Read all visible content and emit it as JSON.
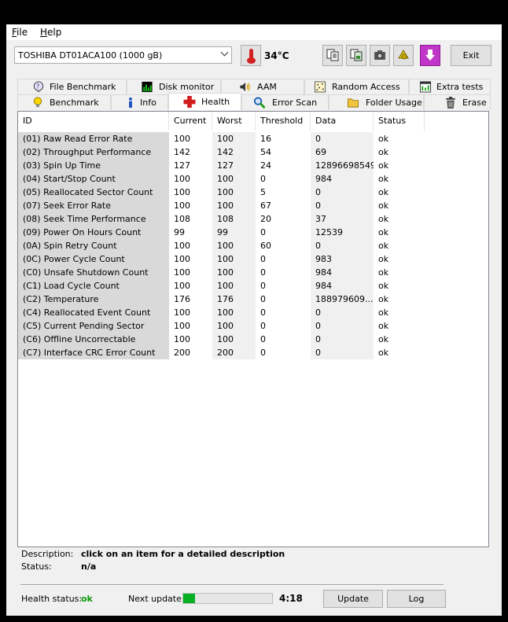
{
  "menu": {
    "file": "File",
    "help": "Help"
  },
  "toolbar": {
    "drive": "TOSHIBA DT01ACA100 (1000 gB)",
    "temperature": "34°C",
    "exit_label": "Exit"
  },
  "tabs_top": [
    {
      "label": "File Benchmark",
      "icon": "file-benchmark-icon"
    },
    {
      "label": "Disk monitor",
      "icon": "disk-monitor-icon"
    },
    {
      "label": "AAM",
      "icon": "speaker-icon"
    },
    {
      "label": "Random Access",
      "icon": "random-access-icon"
    },
    {
      "label": "Extra tests",
      "icon": "extra-tests-icon"
    }
  ],
  "tabs_bottom": [
    {
      "label": "Benchmark",
      "icon": "lightbulb-icon"
    },
    {
      "label": "Info",
      "icon": "info-icon"
    },
    {
      "label": "Health",
      "icon": "health-cross-icon",
      "active": true
    },
    {
      "label": "Error Scan",
      "icon": "magnifier-icon"
    },
    {
      "label": "Folder Usage",
      "icon": "folder-icon"
    },
    {
      "label": "Erase",
      "icon": "trash-icon"
    }
  ],
  "table": {
    "columns": [
      "ID",
      "Current",
      "Worst",
      "Threshold",
      "Data",
      "Status"
    ],
    "rows": [
      [
        "(01) Raw Read Error Rate",
        "100",
        "100",
        "16",
        "0",
        "ok"
      ],
      [
        "(02) Throughput Performance",
        "142",
        "142",
        "54",
        "69",
        "ok"
      ],
      [
        "(03) Spin Up Time",
        "127",
        "127",
        "24",
        "12896698549",
        "ok"
      ],
      [
        "(04) Start/Stop Count",
        "100",
        "100",
        "0",
        "984",
        "ok"
      ],
      [
        "(05) Reallocated Sector Count",
        "100",
        "100",
        "5",
        "0",
        "ok"
      ],
      [
        "(07) Seek Error Rate",
        "100",
        "100",
        "67",
        "0",
        "ok"
      ],
      [
        "(08) Seek Time Performance",
        "108",
        "108",
        "20",
        "37",
        "ok"
      ],
      [
        "(09) Power On Hours Count",
        "99",
        "99",
        "0",
        "12539",
        "ok"
      ],
      [
        "(0A) Spin Retry Count",
        "100",
        "100",
        "60",
        "0",
        "ok"
      ],
      [
        "(0C) Power Cycle Count",
        "100",
        "100",
        "0",
        "983",
        "ok"
      ],
      [
        "(C0) Unsafe Shutdown Count",
        "100",
        "100",
        "0",
        "984",
        "ok"
      ],
      [
        "(C1) Load Cycle Count",
        "100",
        "100",
        "0",
        "984",
        "ok"
      ],
      [
        "(C2) Temperature",
        "176",
        "176",
        "0",
        "188979609...",
        "ok"
      ],
      [
        "(C4) Reallocated Event Count",
        "100",
        "100",
        "0",
        "0",
        "ok"
      ],
      [
        "(C5) Current Pending Sector",
        "100",
        "100",
        "0",
        "0",
        "ok"
      ],
      [
        "(C6) Offline Uncorrectable",
        "100",
        "100",
        "0",
        "0",
        "ok"
      ],
      [
        "(C7) Interface CRC Error Count",
        "200",
        "200",
        "0",
        "0",
        "ok"
      ]
    ]
  },
  "description": {
    "desc_label": "Description:",
    "desc_value": "click on an item for a detailed description",
    "status_label": "Status:",
    "status_value": "n/a"
  },
  "statusbar": {
    "health_label": "Health status:",
    "health_value": "ok",
    "health_color": "#0a9a0a",
    "next_update_label": "Next update:",
    "progress": 0.13,
    "timer": "4:18",
    "update_label": "Update",
    "log_label": "Log"
  }
}
